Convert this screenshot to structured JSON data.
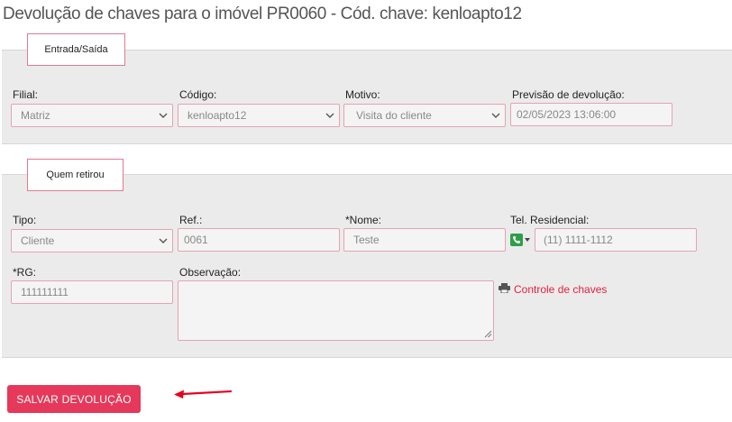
{
  "page": {
    "title": "Devolução de chaves para o imóvel PR0060 - Cód. chave: kenloapto12"
  },
  "section_entry": {
    "tab_label": "Entrada/Saída",
    "filial": {
      "label": "Filial:",
      "value": "Matriz"
    },
    "codigo": {
      "label": "Código:",
      "value": "kenloapto12"
    },
    "motivo": {
      "label": "Motivo:",
      "value": "Visita do cliente"
    },
    "previsao": {
      "label": "Previsão de devolução:",
      "value": "02/05/2023 13:06:00"
    }
  },
  "section_who": {
    "tab_label": "Quem retirou",
    "tipo": {
      "label": "Tipo:",
      "value": "Cliente"
    },
    "ref": {
      "label": "Ref.:",
      "value": "0061"
    },
    "nome": {
      "label": "*Nome:",
      "value": "Teste"
    },
    "tel": {
      "label": "Tel. Residencial:",
      "value": "(11) 1111-1112",
      "icon": "phone-icon"
    },
    "rg": {
      "label": "*RG:",
      "value": "111111111"
    },
    "observacao": {
      "label": "Observação:",
      "value": ""
    },
    "controle_link": {
      "label": "Controle de chaves",
      "icon": "print-icon"
    }
  },
  "actions": {
    "save_label": "SALVAR DEVOLUÇÃO"
  },
  "colors": {
    "accent": "#e6385a",
    "border": "#e3a4b3",
    "panel": "#ebebeb",
    "link": "#e0213f",
    "arrow": "#e8001f"
  }
}
